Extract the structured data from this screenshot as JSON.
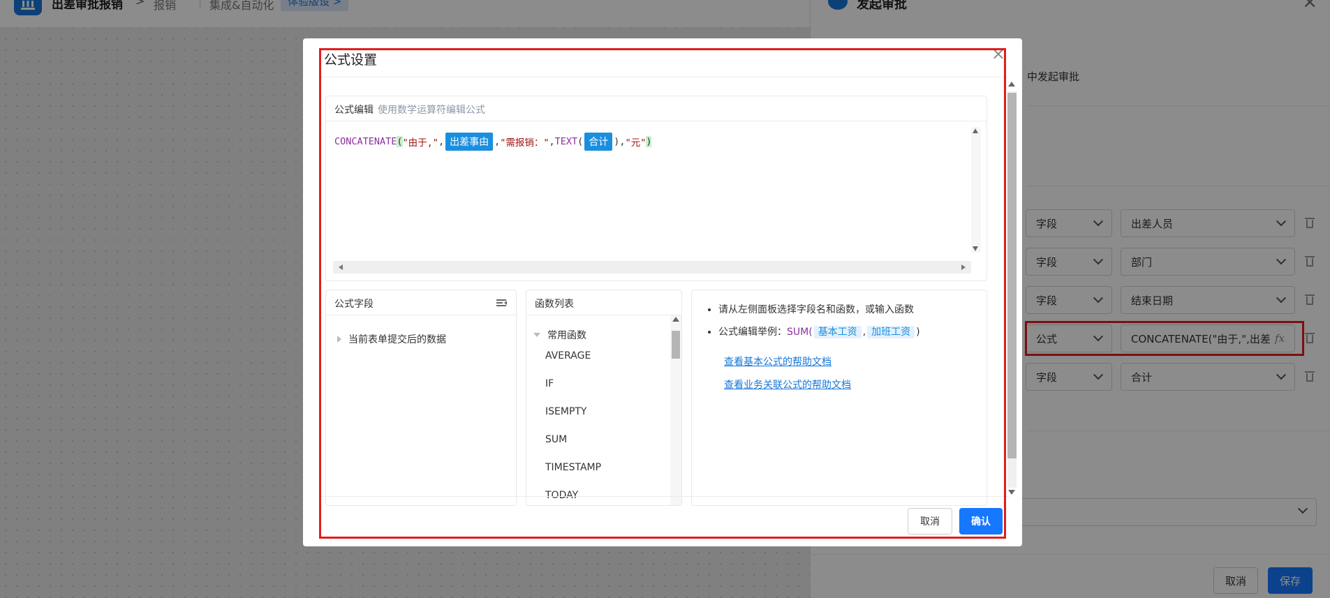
{
  "topbar": {
    "app_title": "出差审批报销",
    "crumbs": [
      "报销",
      "集成&自动化"
    ],
    "badge": "体验版设 >"
  },
  "drawer": {
    "title": "发起审批",
    "description": "中发起审批",
    "rows": [
      {
        "type": "字段",
        "value": "出差人员"
      },
      {
        "type": "字段",
        "value": "部门"
      },
      {
        "type": "字段",
        "value": "结束日期"
      },
      {
        "type": "公式",
        "value": "CONCATENATE(\"由于,\",出差"
      },
      {
        "type": "字段",
        "value": "合计"
      }
    ],
    "cancel_label": "取消",
    "save_label": "保存"
  },
  "modal": {
    "title": "公式设置",
    "editor": {
      "label": "公式编辑",
      "hint": "使用数学运算符编辑公式",
      "formula": {
        "fn1": "CONCATENATE",
        "open1": "(",
        "str1": "\"由于,\"",
        "sep1": ",",
        "field1": "出差事由",
        "sep2": ",",
        "str2": "\"需报销：\"",
        "sep3": ",",
        "fn2": "TEXT",
        "open2": "(",
        "field2": "合计",
        "close2": ")",
        "sep4": ",",
        "str3": "\"元\"",
        "close1": ")"
      }
    },
    "fields_panel": {
      "title": "公式字段",
      "node": "当前表单提交后的数据"
    },
    "funcs_panel": {
      "title": "函数列表",
      "group": "常用函数",
      "items": [
        "AVERAGE",
        "IF",
        "ISEMPTY",
        "SUM",
        "TIMESTAMP",
        "TODAY"
      ]
    },
    "help": {
      "tip1": "请从左侧面板选择字段名和函数，或输入函数",
      "tip2_prefix": "公式编辑举例：",
      "tip2_fn": "SUM(",
      "tip2_chip1": "基本工资",
      "tip2_sep": ",",
      "tip2_chip2": "加班工资",
      "tip2_close": ")",
      "link1": "查看基本公式的帮助文档",
      "link2": "查看业务关联公式的帮助文档"
    },
    "cancel_label": "取消",
    "confirm_label": "确认"
  },
  "colors": {
    "primary": "#1677ff",
    "chip": "#1a8fe0",
    "highlight": "#e31c1c",
    "function": "#8b2e9e",
    "string": "#a11313"
  }
}
